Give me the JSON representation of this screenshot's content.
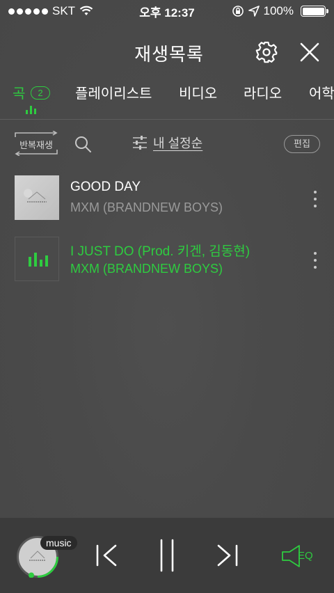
{
  "status_bar": {
    "carrier": "SKT",
    "time": "오후 12:37",
    "battery": "100%"
  },
  "header": {
    "title": "재생목록",
    "settings_icon": "gear-icon",
    "close_icon": "close-icon"
  },
  "tabs": [
    {
      "label": "곡",
      "count": "2",
      "active": true
    },
    {
      "label": "플레이리스트",
      "active": false
    },
    {
      "label": "비디오",
      "active": false
    },
    {
      "label": "라디오",
      "active": false
    },
    {
      "label": "어학",
      "active": false
    }
  ],
  "toolbar": {
    "repeat_label": "반복재생",
    "sort_label": "내 설정순",
    "edit_label": "편집"
  },
  "tracks": [
    {
      "title": "GOOD DAY",
      "artist": "MXM (BRANDNEW BOYS)",
      "playing": false
    },
    {
      "title": "I JUST DO (Prod. 키겐, 김동현)",
      "artist": "MXM (BRANDNEW BOYS)",
      "playing": true
    }
  ],
  "player": {
    "badge": "music",
    "eq_label": "EQ"
  },
  "colors": {
    "accent": "#2ecc40",
    "background": "#4a4a4a",
    "player_bar": "#3b3b3b"
  }
}
